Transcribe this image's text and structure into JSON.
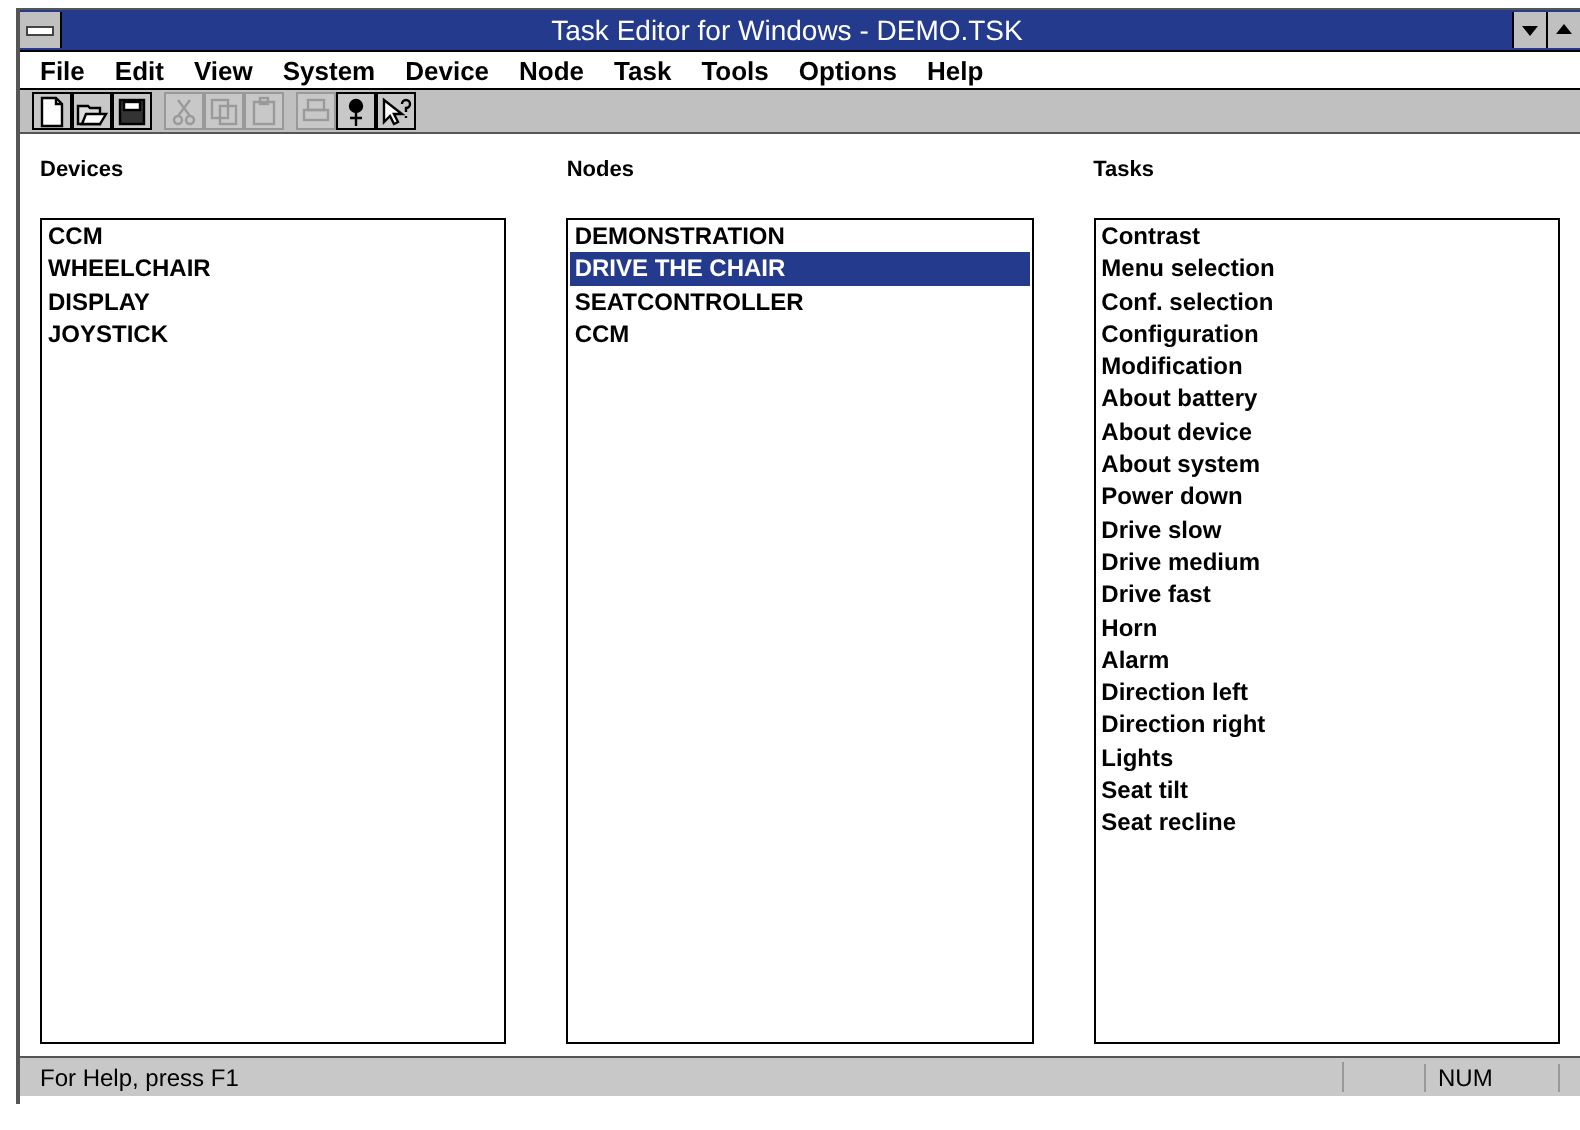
{
  "window": {
    "title": "Task Editor for Windows - DEMO.TSK"
  },
  "menu": [
    "File",
    "Edit",
    "View",
    "System",
    "Device",
    "Node",
    "Task",
    "Tools",
    "Options",
    "Help"
  ],
  "toolbar": [
    {
      "kind": "new",
      "disabled": false
    },
    {
      "kind": "open",
      "disabled": false
    },
    {
      "kind": "save",
      "disabled": false
    },
    {
      "kind": "sep"
    },
    {
      "kind": "cut",
      "disabled": true
    },
    {
      "kind": "copy",
      "disabled": true
    },
    {
      "kind": "paste",
      "disabled": true
    },
    {
      "kind": "sep"
    },
    {
      "kind": "print",
      "disabled": true
    },
    {
      "kind": "pin",
      "disabled": false
    },
    {
      "kind": "help",
      "disabled": false
    }
  ],
  "panels": [
    {
      "label": "Devices",
      "items": [
        {
          "text": "CCM",
          "selected": false
        },
        {
          "text": "WHEELCHAIR",
          "selected": false
        },
        {
          "text": "DISPLAY",
          "selected": false
        },
        {
          "text": "JOYSTICK",
          "selected": false
        }
      ]
    },
    {
      "label": "Nodes",
      "items": [
        {
          "text": "DEMONSTRATION",
          "selected": false
        },
        {
          "text": "DRIVE THE CHAIR",
          "selected": true
        },
        {
          "text": "SEATCONTROLLER",
          "selected": false
        },
        {
          "text": "CCM",
          "selected": false
        }
      ]
    },
    {
      "label": "Tasks",
      "items": [
        {
          "text": "Contrast",
          "selected": false
        },
        {
          "text": "Menu selection",
          "selected": false
        },
        {
          "text": "Conf. selection",
          "selected": false
        },
        {
          "text": "Configuration",
          "selected": false
        },
        {
          "text": "Modification",
          "selected": false
        },
        {
          "text": "About battery",
          "selected": false
        },
        {
          "text": "About device",
          "selected": false
        },
        {
          "text": "About system",
          "selected": false
        },
        {
          "text": "Power down",
          "selected": false
        },
        {
          "text": "Drive slow",
          "selected": false
        },
        {
          "text": "Drive medium",
          "selected": false
        },
        {
          "text": "Drive fast",
          "selected": false
        },
        {
          "text": "Horn",
          "selected": false
        },
        {
          "text": "Alarm",
          "selected": false
        },
        {
          "text": "Direction left",
          "selected": false
        },
        {
          "text": "Direction right",
          "selected": false
        },
        {
          "text": "Lights",
          "selected": false
        },
        {
          "text": "Seat tilt",
          "selected": false
        },
        {
          "text": "Seat recline",
          "selected": false
        }
      ]
    }
  ],
  "status_bar": {
    "message": "For Help, press F1",
    "indicator": "NUM"
  }
}
